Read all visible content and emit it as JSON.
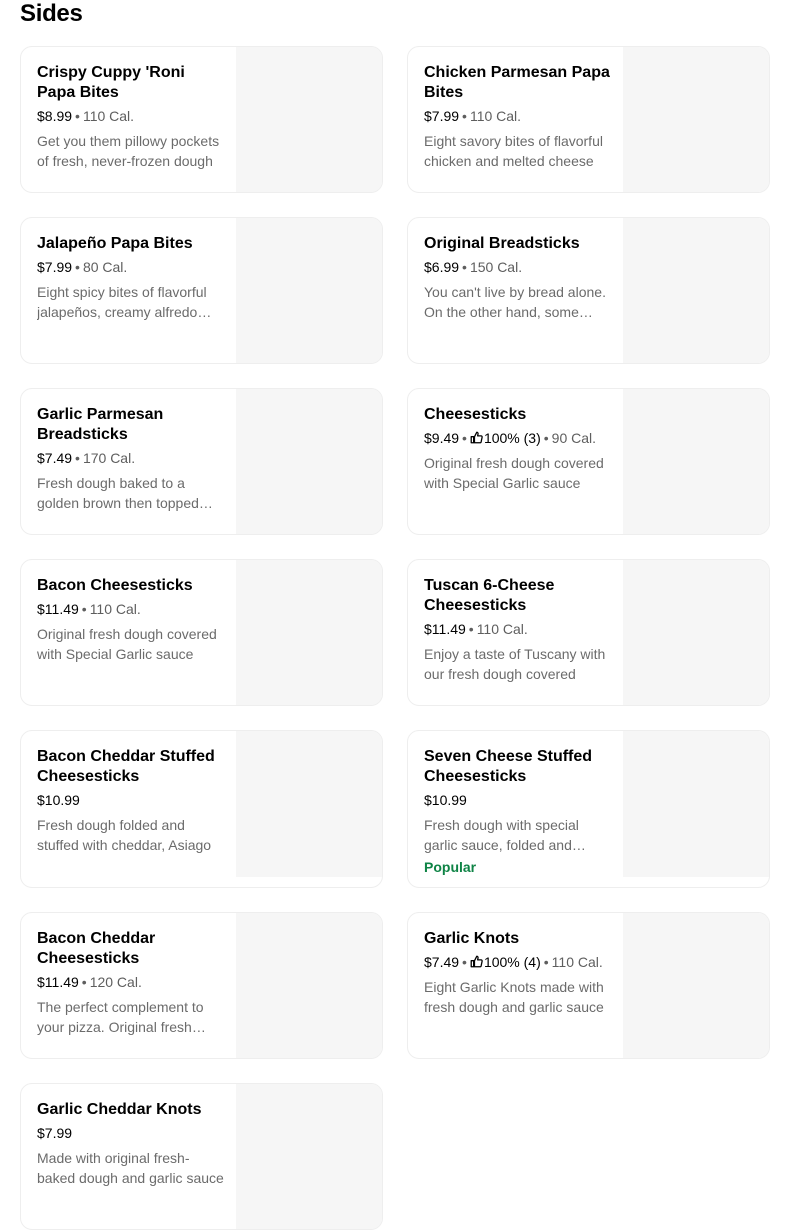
{
  "section": {
    "title": "Sides"
  },
  "items": [
    {
      "name": "Crispy Cuppy 'Roni Papa Bites",
      "price": "$8.99",
      "calories": "110 Cal.",
      "description": "Get you them pillowy pockets of fresh, never-frozen dough"
    },
    {
      "name": "Chicken Parmesan Papa Bites",
      "price": "$7.99",
      "calories": "110 Cal.",
      "description": "Eight savory bites of flavorful chicken and melted cheese"
    },
    {
      "name": "Jalapeño Papa Bites",
      "price": "$7.99",
      "calories": "80 Cal.",
      "description": "Eight spicy bites of flavorful jalapeños, creamy alfredo sauce"
    },
    {
      "name": "Original Breadsticks",
      "price": "$6.99",
      "calories": "150 Cal.",
      "description": "You can't live by bread alone. On the other hand, some days"
    },
    {
      "name": "Garlic Parmesan Breadsticks",
      "price": "$7.49",
      "calories": "170 Cal.",
      "description": "Fresh dough baked to a golden brown then topped with garlic"
    },
    {
      "name": "Cheesesticks",
      "price": "$9.49",
      "rating": "100% (3)",
      "calories": "90 Cal.",
      "description": "Original fresh dough covered with Special Garlic sauce"
    },
    {
      "name": "Bacon Cheesesticks",
      "price": "$11.49",
      "calories": "110 Cal.",
      "description": "Original fresh dough covered with Special Garlic sauce"
    },
    {
      "name": "Tuscan 6-Cheese Cheesesticks",
      "price": "$11.49",
      "calories": "110 Cal.",
      "description": "Enjoy a taste of Tuscany with our fresh dough covered"
    },
    {
      "name": "Bacon Cheddar Stuffed Cheesesticks",
      "price": "$10.99",
      "description": "Fresh dough folded and stuffed with cheddar, Asiago"
    },
    {
      "name": "Seven Cheese Stuffed Cheesesticks",
      "price": "$10.99",
      "description": "Fresh dough with special garlic sauce, folded and stuffed",
      "badge": "Popular"
    },
    {
      "name": "Bacon Cheddar Cheesesticks",
      "price": "$11.49",
      "calories": "120 Cal.",
      "description": "The perfect complement to your pizza. Original fresh dough"
    },
    {
      "name": "Garlic Knots",
      "price": "$7.49",
      "rating": "100% (4)",
      "calories": "110 Cal.",
      "description": "Eight Garlic Knots made with fresh dough and garlic sauce"
    },
    {
      "name": "Garlic Cheddar Knots",
      "price": "$7.99",
      "description": "Made with original fresh-baked dough and garlic sauce"
    }
  ],
  "colors": {
    "popular": "#0e8345",
    "image_placeholder": "#f6f6f6",
    "border": "#eeeeee"
  },
  "icons": {
    "rating": "thumbs-up-icon"
  }
}
